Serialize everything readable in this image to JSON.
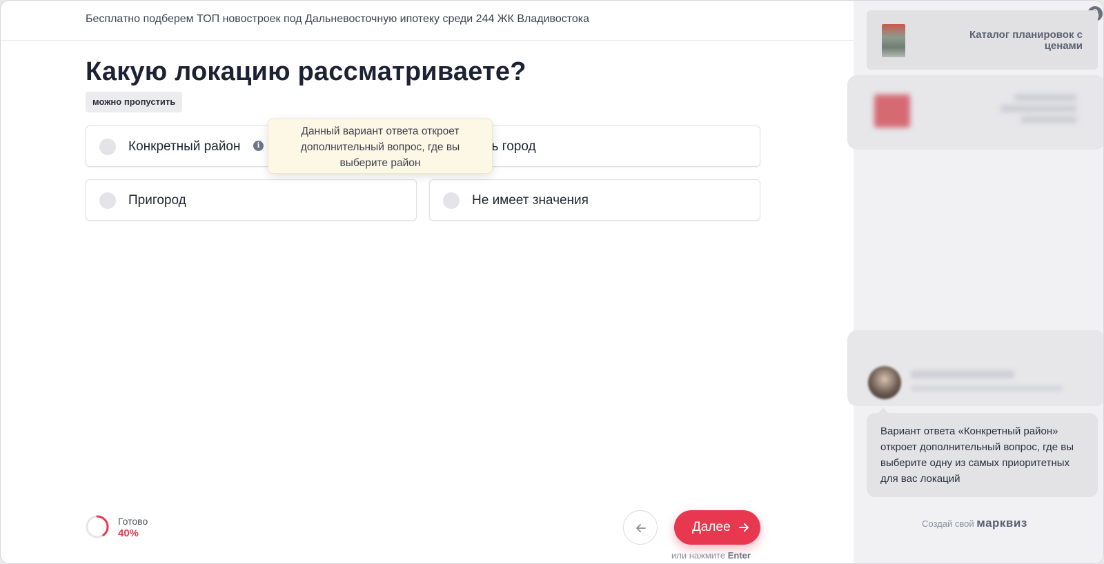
{
  "header": {
    "banner": "Бесплатно подберем ТОП новостроек под Дальневосточную ипотеку среди 244 ЖК Владивостока"
  },
  "question": {
    "title": "Какую локацию рассматриваете?",
    "skip_badge": "можно пропустить",
    "options": [
      {
        "label": "Конкретный район",
        "has_info": true
      },
      {
        "label": "сь город"
      },
      {
        "label": "Пригород"
      },
      {
        "label": "Не имеет значения"
      }
    ],
    "tooltip": "Данный вариант ответа откроет дополнительный вопрос, где вы выберите район"
  },
  "footer": {
    "progress_label": "Готово",
    "progress_value": "40%",
    "progress_fraction": 0.4,
    "next_label": "Далее",
    "enter_hint_prefix": "или нажмите",
    "enter_hint_key": "Enter"
  },
  "sidebar": {
    "catalog_title": "Каталог планировок с ценами",
    "bubble_text": "Вариант ответа «Конкретный район» откроет дополнительный вопрос, где вы выберите одну из самых приоритетных для вас локаций",
    "brand_prefix": "Создай свой",
    "brand_name": "марквиз"
  },
  "colors": {
    "accent": "#e8384f",
    "tooltip_bg": "#fdf8e6",
    "sidebar_bg": "#f1f1f3"
  },
  "icons": [
    "info-icon",
    "arrow-left-icon",
    "arrow-right-icon",
    "lock-icon"
  ]
}
